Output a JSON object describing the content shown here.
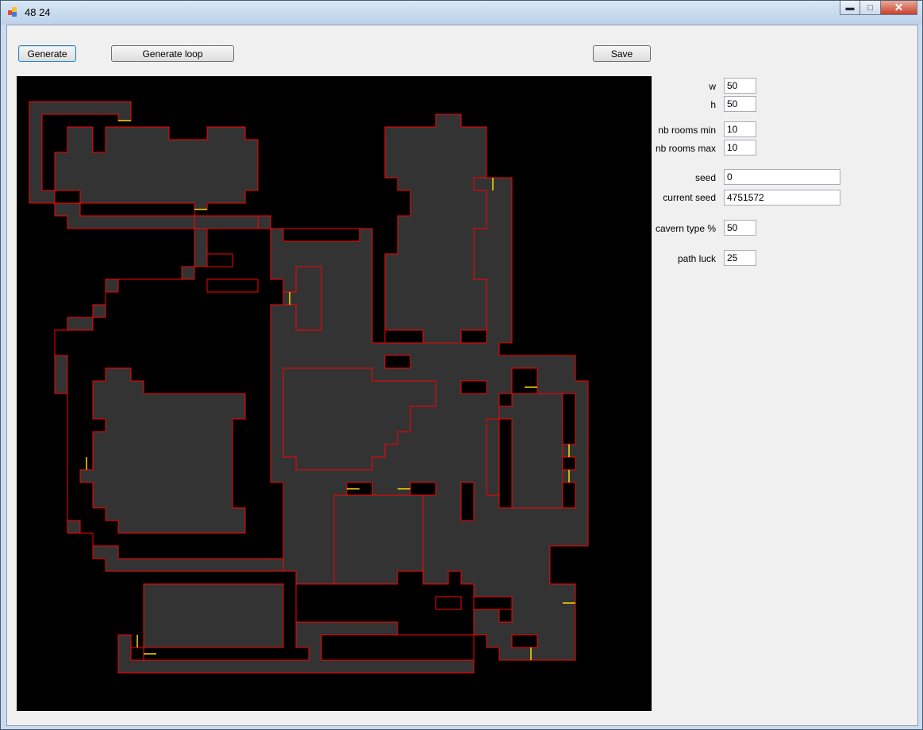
{
  "window": {
    "title": "48   24"
  },
  "toolbar": {
    "generate_label": "Generate",
    "loop_label": "Generate loop",
    "save_label": "Save"
  },
  "params": [
    {
      "label": "w",
      "value": "50"
    },
    {
      "label": "h",
      "value": "50"
    },
    {
      "label": "nb rooms min",
      "value": "10"
    },
    {
      "label": "nb rooms max",
      "value": "10"
    },
    {
      "label": "seed",
      "value": "0"
    },
    {
      "label": "current seed",
      "value": "4751572"
    },
    {
      "label": "cavern type %",
      "value": "50"
    },
    {
      "label": "path luck",
      "value": "25"
    }
  ],
  "map": {
    "background": "#000000",
    "floor": "#333333",
    "wall": "#ff0000",
    "door": "#ffd700"
  }
}
